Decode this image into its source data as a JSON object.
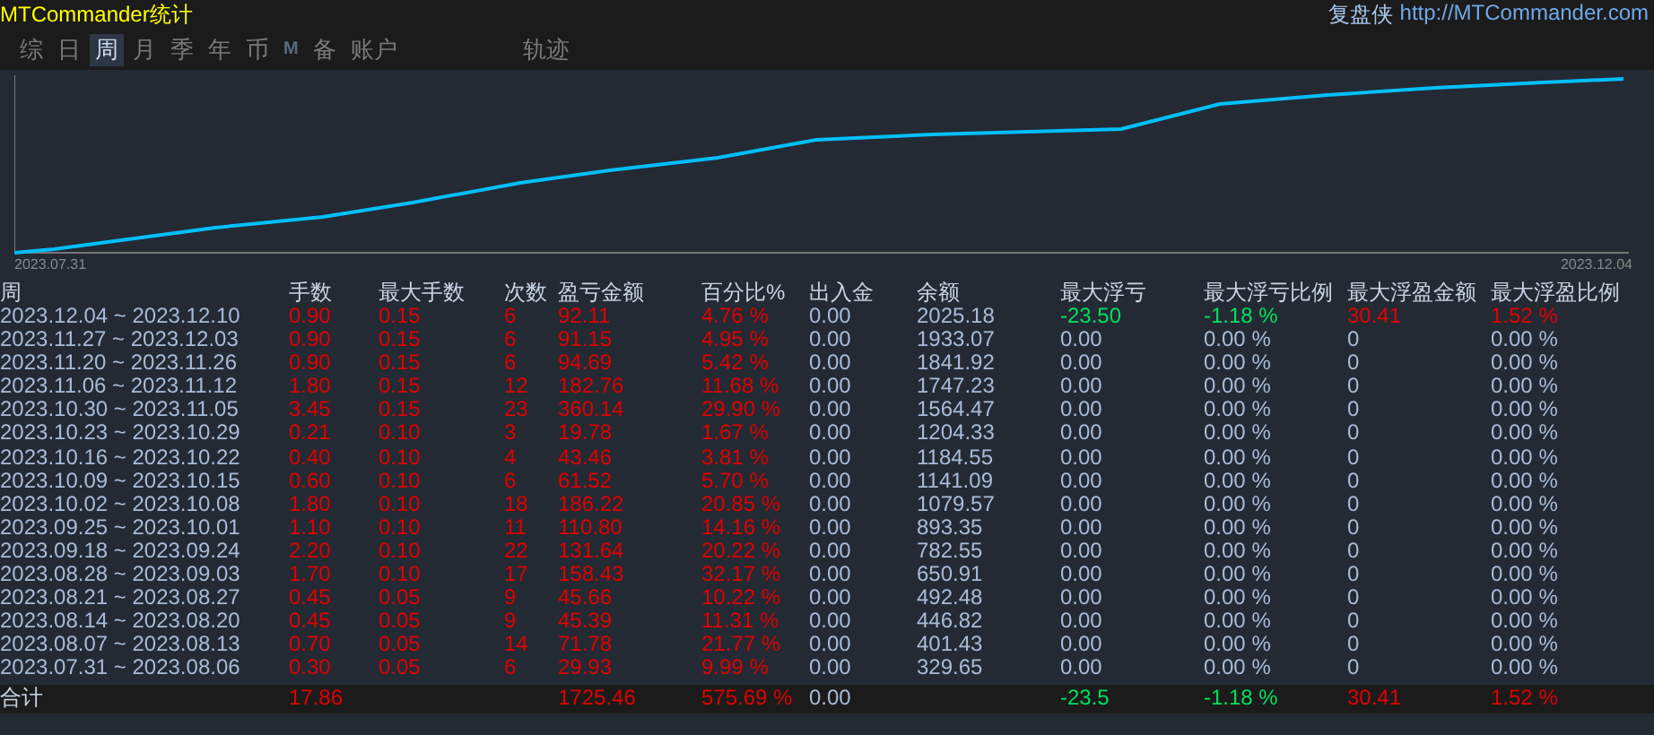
{
  "window": {
    "title": "MTCommander统计",
    "brand": "复盘侠",
    "link": "http://MTCommander.com"
  },
  "tabs": [
    {
      "label": "综",
      "selected": false,
      "kind": "text"
    },
    {
      "label": "日",
      "selected": false,
      "kind": "text"
    },
    {
      "label": "周",
      "selected": true,
      "kind": "text"
    },
    {
      "label": "月",
      "selected": false,
      "kind": "text"
    },
    {
      "label": "季",
      "selected": false,
      "kind": "text"
    },
    {
      "label": "年",
      "selected": false,
      "kind": "text"
    },
    {
      "label": "币",
      "selected": false,
      "kind": "text"
    },
    {
      "label": "M",
      "selected": false,
      "kind": "mark"
    },
    {
      "label": "备",
      "selected": false,
      "kind": "text"
    },
    {
      "label": "账户",
      "selected": false,
      "kind": "text"
    },
    {
      "label": "轨迹",
      "selected": false,
      "kind": "spaced"
    }
  ],
  "chart": {
    "start_label": "2023.07.31",
    "end_label": "2023.12.04"
  },
  "table": {
    "columns": [
      "周",
      "手数",
      "最大手数",
      "次数",
      "盈亏金额",
      "百分比%",
      "出入金",
      "余额",
      "最大浮亏",
      "最大浮亏比例",
      "最大浮盈金额",
      "最大浮盈比例"
    ],
    "rows": [
      {
        "cells": [
          {
            "text": "2023.12.04 ~ 2023.12.10",
            "color": "#a8bcd8"
          },
          {
            "text": "0.90",
            "color": "#e00000"
          },
          {
            "text": "0.15",
            "color": "#e00000"
          },
          {
            "text": "6",
            "color": "#e00000"
          },
          {
            "text": "92.11",
            "color": "#e00000"
          },
          {
            "text": "4.76 %",
            "color": "#e00000"
          },
          {
            "text": "0.00",
            "color": "#a8bcd8"
          },
          {
            "text": "2025.18",
            "color": "#a8bcd8"
          },
          {
            "text": "-23.50",
            "color": "#00e060"
          },
          {
            "text": "-1.18 %",
            "color": "#00e060"
          },
          {
            "text": "30.41",
            "color": "#e00000"
          },
          {
            "text": "1.52 %",
            "color": "#e00000"
          }
        ]
      },
      {
        "cells": [
          {
            "text": "2023.11.27 ~ 2023.12.03",
            "color": "#a8bcd8"
          },
          {
            "text": "0.90",
            "color": "#e00000"
          },
          {
            "text": "0.15",
            "color": "#e00000"
          },
          {
            "text": "6",
            "color": "#e00000"
          },
          {
            "text": "91.15",
            "color": "#e00000"
          },
          {
            "text": "4.95 %",
            "color": "#e00000"
          },
          {
            "text": "0.00",
            "color": "#a8bcd8"
          },
          {
            "text": "1933.07",
            "color": "#a8bcd8"
          },
          {
            "text": "0.00",
            "color": "#a8bcd8"
          },
          {
            "text": "0.00 %",
            "color": "#a8bcd8"
          },
          {
            "text": "0",
            "color": "#a8bcd8"
          },
          {
            "text": "0.00 %",
            "color": "#a8bcd8"
          }
        ]
      },
      {
        "cells": [
          {
            "text": "2023.11.20 ~ 2023.11.26",
            "color": "#a8bcd8"
          },
          {
            "text": "0.90",
            "color": "#e00000"
          },
          {
            "text": "0.15",
            "color": "#e00000"
          },
          {
            "text": "6",
            "color": "#e00000"
          },
          {
            "text": "94.69",
            "color": "#e00000"
          },
          {
            "text": "5.42 %",
            "color": "#e00000"
          },
          {
            "text": "0.00",
            "color": "#a8bcd8"
          },
          {
            "text": "1841.92",
            "color": "#a8bcd8"
          },
          {
            "text": "0.00",
            "color": "#a8bcd8"
          },
          {
            "text": "0.00 %",
            "color": "#a8bcd8"
          },
          {
            "text": "0",
            "color": "#a8bcd8"
          },
          {
            "text": "0.00 %",
            "color": "#a8bcd8"
          }
        ]
      },
      {
        "cells": [
          {
            "text": "2023.11.06 ~ 2023.11.12",
            "color": "#a8bcd8"
          },
          {
            "text": "1.80",
            "color": "#e00000"
          },
          {
            "text": "0.15",
            "color": "#e00000"
          },
          {
            "text": "12",
            "color": "#e00000"
          },
          {
            "text": "182.76",
            "color": "#e00000"
          },
          {
            "text": "11.68 %",
            "color": "#e00000"
          },
          {
            "text": "0.00",
            "color": "#a8bcd8"
          },
          {
            "text": "1747.23",
            "color": "#a8bcd8"
          },
          {
            "text": "0.00",
            "color": "#a8bcd8"
          },
          {
            "text": "0.00 %",
            "color": "#a8bcd8"
          },
          {
            "text": "0",
            "color": "#a8bcd8"
          },
          {
            "text": "0.00 %",
            "color": "#a8bcd8"
          }
        ]
      },
      {
        "cells": [
          {
            "text": "2023.10.30 ~ 2023.11.05",
            "color": "#a8bcd8"
          },
          {
            "text": "3.45",
            "color": "#e00000"
          },
          {
            "text": "0.15",
            "color": "#e00000"
          },
          {
            "text": "23",
            "color": "#e00000"
          },
          {
            "text": "360.14",
            "color": "#e00000"
          },
          {
            "text": "29.90 %",
            "color": "#e00000"
          },
          {
            "text": "0.00",
            "color": "#a8bcd8"
          },
          {
            "text": "1564.47",
            "color": "#a8bcd8"
          },
          {
            "text": "0.00",
            "color": "#a8bcd8"
          },
          {
            "text": "0.00 %",
            "color": "#a8bcd8"
          },
          {
            "text": "0",
            "color": "#a8bcd8"
          },
          {
            "text": "0.00 %",
            "color": "#a8bcd8"
          }
        ]
      },
      {
        "cells": [
          {
            "text": "2023.10.23 ~ 2023.10.29",
            "color": "#a8bcd8"
          },
          {
            "text": "0.21",
            "color": "#e00000"
          },
          {
            "text": "0.10",
            "color": "#e00000"
          },
          {
            "text": "3",
            "color": "#e00000"
          },
          {
            "text": "19.78",
            "color": "#e00000"
          },
          {
            "text": "1.67 %",
            "color": "#e00000"
          },
          {
            "text": "0.00",
            "color": "#a8bcd8"
          },
          {
            "text": "1204.33",
            "color": "#a8bcd8"
          },
          {
            "text": "0.00",
            "color": "#a8bcd8"
          },
          {
            "text": "0.00 %",
            "color": "#a8bcd8"
          },
          {
            "text": "0",
            "color": "#a8bcd8"
          },
          {
            "text": "0.00 %",
            "color": "#a8bcd8"
          }
        ]
      },
      {
        "cells": [
          {
            "text": "2023.10.16 ~ 2023.10.22",
            "color": "#a8bcd8"
          },
          {
            "text": "0.40",
            "color": "#e00000"
          },
          {
            "text": "0.10",
            "color": "#e00000"
          },
          {
            "text": "4",
            "color": "#e00000"
          },
          {
            "text": "43.46",
            "color": "#e00000"
          },
          {
            "text": "3.81 %",
            "color": "#e00000"
          },
          {
            "text": "0.00",
            "color": "#a8bcd8"
          },
          {
            "text": "1184.55",
            "color": "#a8bcd8"
          },
          {
            "text": "0.00",
            "color": "#a8bcd8"
          },
          {
            "text": "0.00 %",
            "color": "#a8bcd8"
          },
          {
            "text": "0",
            "color": "#a8bcd8"
          },
          {
            "text": "0.00 %",
            "color": "#a8bcd8"
          }
        ]
      },
      {
        "cells": [
          {
            "text": "2023.10.09 ~ 2023.10.15",
            "color": "#a8bcd8"
          },
          {
            "text": "0.60",
            "color": "#e00000"
          },
          {
            "text": "0.10",
            "color": "#e00000"
          },
          {
            "text": "6",
            "color": "#e00000"
          },
          {
            "text": "61.52",
            "color": "#e00000"
          },
          {
            "text": "5.70 %",
            "color": "#e00000"
          },
          {
            "text": "0.00",
            "color": "#a8bcd8"
          },
          {
            "text": "1141.09",
            "color": "#a8bcd8"
          },
          {
            "text": "0.00",
            "color": "#a8bcd8"
          },
          {
            "text": "0.00 %",
            "color": "#a8bcd8"
          },
          {
            "text": "0",
            "color": "#a8bcd8"
          },
          {
            "text": "0.00 %",
            "color": "#a8bcd8"
          }
        ]
      },
      {
        "cells": [
          {
            "text": "2023.10.02 ~ 2023.10.08",
            "color": "#a8bcd8"
          },
          {
            "text": "1.80",
            "color": "#e00000"
          },
          {
            "text": "0.10",
            "color": "#e00000"
          },
          {
            "text": "18",
            "color": "#e00000"
          },
          {
            "text": "186.22",
            "color": "#e00000"
          },
          {
            "text": "20.85 %",
            "color": "#e00000"
          },
          {
            "text": "0.00",
            "color": "#a8bcd8"
          },
          {
            "text": "1079.57",
            "color": "#a8bcd8"
          },
          {
            "text": "0.00",
            "color": "#a8bcd8"
          },
          {
            "text": "0.00 %",
            "color": "#a8bcd8"
          },
          {
            "text": "0",
            "color": "#a8bcd8"
          },
          {
            "text": "0.00 %",
            "color": "#a8bcd8"
          }
        ]
      },
      {
        "cells": [
          {
            "text": "2023.09.25 ~ 2023.10.01",
            "color": "#a8bcd8"
          },
          {
            "text": "1.10",
            "color": "#e00000"
          },
          {
            "text": "0.10",
            "color": "#e00000"
          },
          {
            "text": "11",
            "color": "#e00000"
          },
          {
            "text": "110.80",
            "color": "#e00000"
          },
          {
            "text": "14.16 %",
            "color": "#e00000"
          },
          {
            "text": "0.00",
            "color": "#a8bcd8"
          },
          {
            "text": "893.35",
            "color": "#a8bcd8"
          },
          {
            "text": "0.00",
            "color": "#a8bcd8"
          },
          {
            "text": "0.00 %",
            "color": "#a8bcd8"
          },
          {
            "text": "0",
            "color": "#a8bcd8"
          },
          {
            "text": "0.00 %",
            "color": "#a8bcd8"
          }
        ]
      },
      {
        "cells": [
          {
            "text": "2023.09.18 ~ 2023.09.24",
            "color": "#a8bcd8"
          },
          {
            "text": "2.20",
            "color": "#e00000"
          },
          {
            "text": "0.10",
            "color": "#e00000"
          },
          {
            "text": "22",
            "color": "#e00000"
          },
          {
            "text": "131.64",
            "color": "#e00000"
          },
          {
            "text": "20.22 %",
            "color": "#e00000"
          },
          {
            "text": "0.00",
            "color": "#a8bcd8"
          },
          {
            "text": "782.55",
            "color": "#a8bcd8"
          },
          {
            "text": "0.00",
            "color": "#a8bcd8"
          },
          {
            "text": "0.00 %",
            "color": "#a8bcd8"
          },
          {
            "text": "0",
            "color": "#a8bcd8"
          },
          {
            "text": "0.00 %",
            "color": "#a8bcd8"
          }
        ]
      },
      {
        "cells": [
          {
            "text": "2023.08.28 ~ 2023.09.03",
            "color": "#a8bcd8"
          },
          {
            "text": "1.70",
            "color": "#e00000"
          },
          {
            "text": "0.10",
            "color": "#e00000"
          },
          {
            "text": "17",
            "color": "#e00000"
          },
          {
            "text": "158.43",
            "color": "#e00000"
          },
          {
            "text": "32.17 %",
            "color": "#e00000"
          },
          {
            "text": "0.00",
            "color": "#a8bcd8"
          },
          {
            "text": "650.91",
            "color": "#a8bcd8"
          },
          {
            "text": "0.00",
            "color": "#a8bcd8"
          },
          {
            "text": "0.00 %",
            "color": "#a8bcd8"
          },
          {
            "text": "0",
            "color": "#a8bcd8"
          },
          {
            "text": "0.00 %",
            "color": "#a8bcd8"
          }
        ]
      },
      {
        "cells": [
          {
            "text": "2023.08.21 ~ 2023.08.27",
            "color": "#a8bcd8"
          },
          {
            "text": "0.45",
            "color": "#e00000"
          },
          {
            "text": "0.05",
            "color": "#e00000"
          },
          {
            "text": "9",
            "color": "#e00000"
          },
          {
            "text": "45.66",
            "color": "#e00000"
          },
          {
            "text": "10.22 %",
            "color": "#e00000"
          },
          {
            "text": "0.00",
            "color": "#a8bcd8"
          },
          {
            "text": "492.48",
            "color": "#a8bcd8"
          },
          {
            "text": "0.00",
            "color": "#a8bcd8"
          },
          {
            "text": "0.00 %",
            "color": "#a8bcd8"
          },
          {
            "text": "0",
            "color": "#a8bcd8"
          },
          {
            "text": "0.00 %",
            "color": "#a8bcd8"
          }
        ]
      },
      {
        "cells": [
          {
            "text": "2023.08.14 ~ 2023.08.20",
            "color": "#a8bcd8"
          },
          {
            "text": "0.45",
            "color": "#e00000"
          },
          {
            "text": "0.05",
            "color": "#e00000"
          },
          {
            "text": "9",
            "color": "#e00000"
          },
          {
            "text": "45.39",
            "color": "#e00000"
          },
          {
            "text": "11.31 %",
            "color": "#e00000"
          },
          {
            "text": "0.00",
            "color": "#a8bcd8"
          },
          {
            "text": "446.82",
            "color": "#a8bcd8"
          },
          {
            "text": "0.00",
            "color": "#a8bcd8"
          },
          {
            "text": "0.00 %",
            "color": "#a8bcd8"
          },
          {
            "text": "0",
            "color": "#a8bcd8"
          },
          {
            "text": "0.00 %",
            "color": "#a8bcd8"
          }
        ]
      },
      {
        "cells": [
          {
            "text": "2023.08.07 ~ 2023.08.13",
            "color": "#a8bcd8"
          },
          {
            "text": "0.70",
            "color": "#e00000"
          },
          {
            "text": "0.05",
            "color": "#e00000"
          },
          {
            "text": "14",
            "color": "#e00000"
          },
          {
            "text": "71.78",
            "color": "#e00000"
          },
          {
            "text": "21.77 %",
            "color": "#e00000"
          },
          {
            "text": "0.00",
            "color": "#a8bcd8"
          },
          {
            "text": "401.43",
            "color": "#a8bcd8"
          },
          {
            "text": "0.00",
            "color": "#a8bcd8"
          },
          {
            "text": "0.00 %",
            "color": "#a8bcd8"
          },
          {
            "text": "0",
            "color": "#a8bcd8"
          },
          {
            "text": "0.00 %",
            "color": "#a8bcd8"
          }
        ]
      },
      {
        "cells": [
          {
            "text": "2023.07.31 ~ 2023.08.06",
            "color": "#a8bcd8"
          },
          {
            "text": "0.30",
            "color": "#e00000"
          },
          {
            "text": "0.05",
            "color": "#e00000"
          },
          {
            "text": "6",
            "color": "#e00000"
          },
          {
            "text": "29.93",
            "color": "#e00000"
          },
          {
            "text": "9.99 %",
            "color": "#e00000"
          },
          {
            "text": "0.00",
            "color": "#a8bcd8"
          },
          {
            "text": "329.65",
            "color": "#a8bcd8"
          },
          {
            "text": "0.00",
            "color": "#a8bcd8"
          },
          {
            "text": "0.00 %",
            "color": "#a8bcd8"
          },
          {
            "text": "0",
            "color": "#a8bcd8"
          },
          {
            "text": "0.00 %",
            "color": "#a8bcd8"
          }
        ]
      }
    ],
    "total": {
      "cells": [
        {
          "text": "合计",
          "color": "#c8d4e4"
        },
        {
          "text": "17.86",
          "color": "#e00000"
        },
        null,
        null,
        {
          "text": "1725.46",
          "color": "#e00000"
        },
        {
          "text": "575.69 %",
          "color": "#e00000"
        },
        {
          "text": "0.00",
          "color": "#a8bcd8"
        },
        null,
        {
          "text": "-23.5",
          "color": "#00e060"
        },
        {
          "text": "-1.18 %",
          "color": "#00e060"
        },
        {
          "text": "30.41",
          "color": "#e00000"
        },
        {
          "text": "1.52 %",
          "color": "#e00000"
        }
      ]
    }
  }
}
